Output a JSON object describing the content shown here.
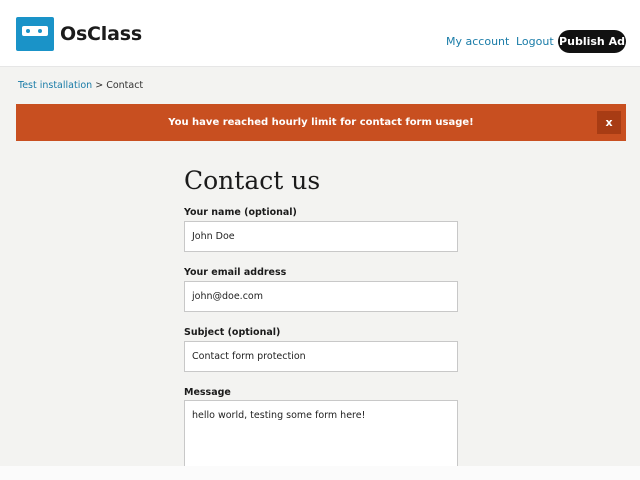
{
  "header": {
    "logo_text": "OsClass",
    "links": [
      "My account",
      "Logout"
    ],
    "publish_label": "Publish Ad"
  },
  "breadcrumb": {
    "home": "Test installation",
    "separator": " > ",
    "current": "Contact"
  },
  "alert": {
    "message": "You have reached hourly limit for contact form usage!",
    "close_label": "x",
    "color": "#c84f20"
  },
  "form": {
    "title": "Contact us",
    "name_label": "Your name (optional)",
    "name_value": "John Doe",
    "email_label": "Your email address",
    "email_value": "john@doe.com",
    "subject_label": "Subject (optional)",
    "subject_value": "Contact form protection",
    "message_label": "Message",
    "message_value": "hello world, testing some form here!"
  },
  "colors": {
    "accent": "#1a93c8",
    "link": "#1a7ca8",
    "background": "#f3f3f1"
  }
}
